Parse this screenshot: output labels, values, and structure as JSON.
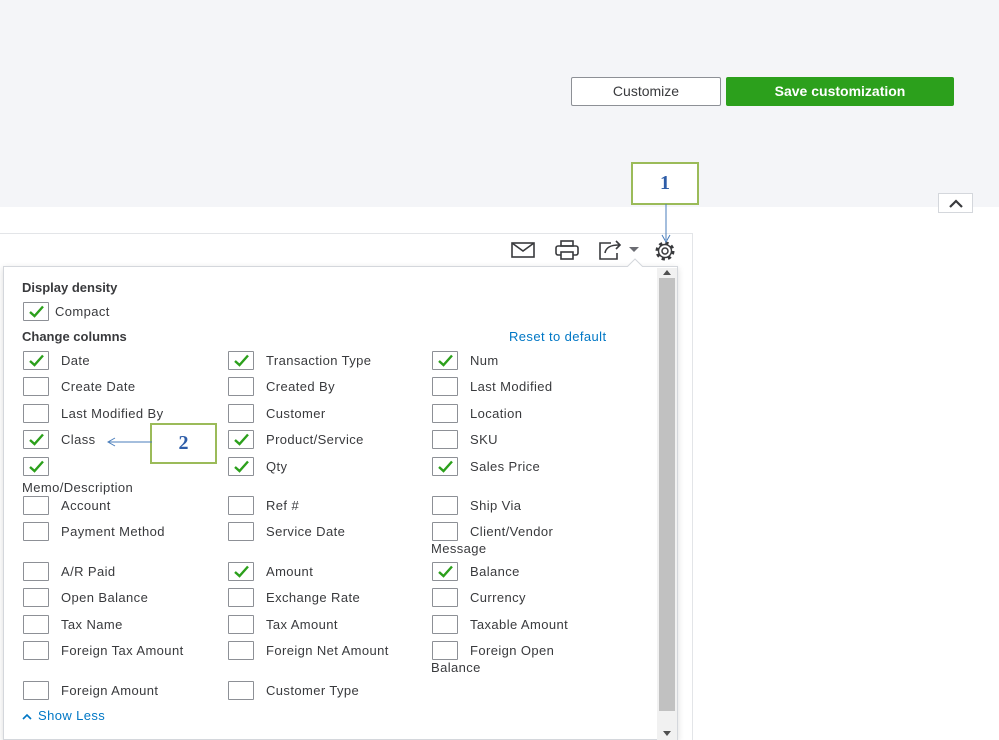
{
  "header": {
    "customize_label": "Customize",
    "save_label": "Save customization"
  },
  "toolbar": {
    "icons": [
      "email-icon",
      "print-icon",
      "export-icon",
      "gear-icon"
    ]
  },
  "callouts": {
    "one": "1",
    "two": "2"
  },
  "panel": {
    "density_heading": "Display density",
    "compact": {
      "label": "Compact",
      "checked": true
    },
    "columns_heading": "Change columns",
    "reset_label": "Reset to default",
    "show_less_label": "Show Less",
    "options": [
      {
        "label": "Date",
        "checked": true
      },
      {
        "label": "Transaction Type",
        "checked": true
      },
      {
        "label": "Num",
        "checked": true
      },
      {
        "label": "Create Date",
        "checked": false
      },
      {
        "label": "Created By",
        "checked": false
      },
      {
        "label": "Last Modified",
        "checked": false
      },
      {
        "label": "Last Modified By",
        "checked": false
      },
      {
        "label": "Customer",
        "checked": false
      },
      {
        "label": "Location",
        "checked": false
      },
      {
        "label": "Class",
        "checked": true
      },
      {
        "label": "Product/Service",
        "checked": true
      },
      {
        "label": "SKU",
        "checked": false
      },
      {
        "label": "Memo/Description",
        "checked": true
      },
      {
        "label": "Qty",
        "checked": true
      },
      {
        "label": "Sales Price",
        "checked": true
      },
      {
        "label": "Account",
        "checked": false
      },
      {
        "label": "Ref #",
        "checked": false
      },
      {
        "label": "Ship Via",
        "checked": false
      },
      {
        "label": "Payment Method",
        "checked": false
      },
      {
        "label": "Service Date",
        "checked": false
      },
      {
        "label": "Client/Vendor Message",
        "checked": false
      },
      {
        "label": "A/R Paid",
        "checked": false
      },
      {
        "label": "Amount",
        "checked": true
      },
      {
        "label": "Balance",
        "checked": true
      },
      {
        "label": "Open Balance",
        "checked": false
      },
      {
        "label": "Exchange Rate",
        "checked": false
      },
      {
        "label": "Currency",
        "checked": false
      },
      {
        "label": "Tax Name",
        "checked": false
      },
      {
        "label": "Tax Amount",
        "checked": false
      },
      {
        "label": "Taxable Amount",
        "checked": false
      },
      {
        "label": "Foreign Tax Amount",
        "checked": false
      },
      {
        "label": "Foreign Net Amount",
        "checked": false
      },
      {
        "label": "Foreign Open Balance",
        "checked": false
      },
      {
        "label": "Foreign Amount",
        "checked": false
      },
      {
        "label": "Customer Type",
        "checked": false
      }
    ]
  },
  "colors": {
    "accent_green": "#2ca01c",
    "link_blue": "#0077c5",
    "callout_border": "#9bbb59",
    "callout_text": "#2e5da8"
  }
}
